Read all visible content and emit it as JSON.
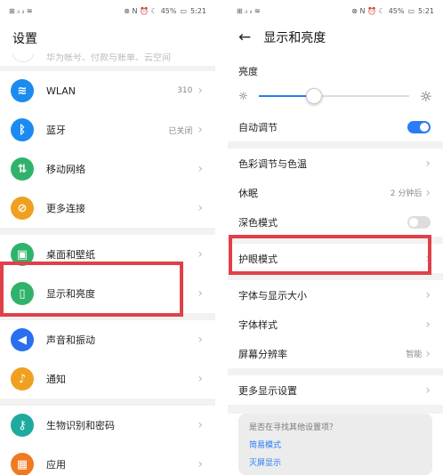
{
  "status_bar": {
    "left_icons": "⊞ ᵢₗ ᵢₗ ≋",
    "right_icons": "⊗ N ⏰ ☾",
    "battery": "45%",
    "time": "5:21"
  },
  "left": {
    "title": "设置",
    "cut_text": "华为帐号、付款与账单、云空间",
    "groups": [
      [
        {
          "label": "WLAN",
          "value": "310",
          "icon": "wifi-icon",
          "color": "#1b8bf0",
          "glyph": "≋"
        },
        {
          "label": "蓝牙",
          "value": "已关闭",
          "icon": "bluetooth-icon",
          "color": "#1b8bf0",
          "glyph": "ᛒ"
        },
        {
          "label": "移动网络",
          "value": "",
          "icon": "mobile-network-icon",
          "color": "#2fb36a",
          "glyph": "⇅"
        },
        {
          "label": "更多连接",
          "value": "",
          "icon": "link-icon",
          "color": "#f0a020",
          "glyph": "⊘"
        }
      ],
      [
        {
          "label": "桌面和壁纸",
          "value": "",
          "icon": "wallpaper-icon",
          "color": "#2fb36a",
          "glyph": "▣"
        },
        {
          "label": "显示和亮度",
          "value": "",
          "icon": "display-icon",
          "color": "#2fb36a",
          "glyph": "▯"
        }
      ],
      [
        {
          "label": "声音和振动",
          "value": "",
          "icon": "sound-icon",
          "color": "#2a6ff0",
          "glyph": "◀"
        },
        {
          "label": "通知",
          "value": "",
          "icon": "bell-icon",
          "color": "#f0a020",
          "glyph": "♪"
        }
      ],
      [
        {
          "label": "生物识别和密码",
          "value": "",
          "icon": "key-icon",
          "color": "#1faa9f",
          "glyph": "⚷"
        },
        {
          "label": "应用",
          "value": "",
          "icon": "apps-icon",
          "color": "#f07a20",
          "glyph": "▦"
        }
      ]
    ]
  },
  "right": {
    "title": "显示和亮度",
    "brightness_label": "亮度",
    "brightness_level": 0.37,
    "auto_adjust": {
      "label": "自动调节",
      "on": true
    },
    "items_a": [
      {
        "label": "色彩调节与色温",
        "value": "",
        "kind": "chevron"
      },
      {
        "label": "休眠",
        "value": "2 分钟后",
        "kind": "chevron"
      },
      {
        "label": "深色模式",
        "value": "",
        "kind": "toggle-off"
      }
    ],
    "eye_mode": {
      "label": "护眼模式"
    },
    "items_b": [
      {
        "label": "字体与显示大小",
        "value": ""
      },
      {
        "label": "字体样式",
        "value": ""
      },
      {
        "label": "屏幕分辨率",
        "value": "智能"
      }
    ],
    "more_display": {
      "label": "更多显示设置"
    },
    "suggest": {
      "question": "是否在寻找其他设置项？",
      "links": [
        "简易模式",
        "灭屏显示"
      ]
    }
  },
  "colors": {
    "accent": "#2a7bf6",
    "highlight": "#e0404a"
  }
}
